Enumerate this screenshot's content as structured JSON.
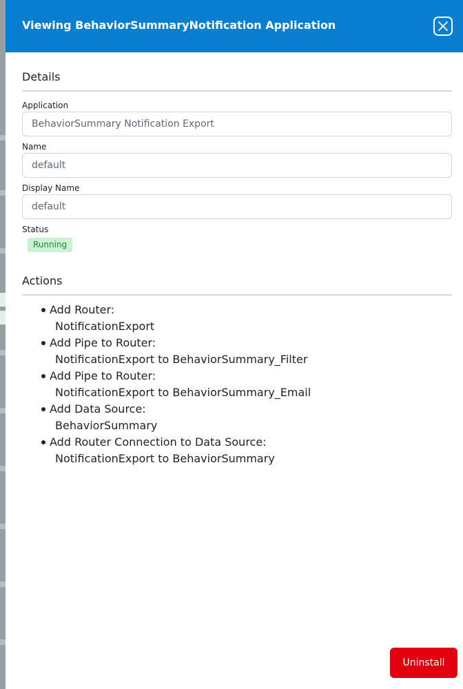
{
  "header": {
    "title": "Viewing BehaviorSummaryNotification Application",
    "close_icon": "close-icon"
  },
  "details": {
    "section_title": "Details",
    "application": {
      "label": "Application",
      "value": "BehaviorSummary Notification Export"
    },
    "name": {
      "label": "Name",
      "value": "default"
    },
    "display_name": {
      "label": "Display Name",
      "value": "default"
    },
    "status": {
      "label": "Status",
      "value": "Running"
    }
  },
  "actions": {
    "section_title": "Actions",
    "items": [
      {
        "label": "Add Router:",
        "detail": "NotificationExport"
      },
      {
        "label": "Add Pipe to Router:",
        "detail": "NotificationExport to BehaviorSummary_Filter"
      },
      {
        "label": "Add Pipe to Router:",
        "detail": "NotificationExport to BehaviorSummary_Email"
      },
      {
        "label": "Add Data Source:",
        "detail": "BehaviorSummary"
      },
      {
        "label": "Add Router Connection to Data Source:",
        "detail": "NotificationExport to BehaviorSummary"
      }
    ]
  },
  "footer": {
    "uninstall_label": "Uninstall"
  },
  "colors": {
    "header_bg": "#0a7ed0",
    "status_bg": "#c9f1d2",
    "status_text": "#1f8a3b",
    "uninstall_bg": "#e3000f"
  }
}
